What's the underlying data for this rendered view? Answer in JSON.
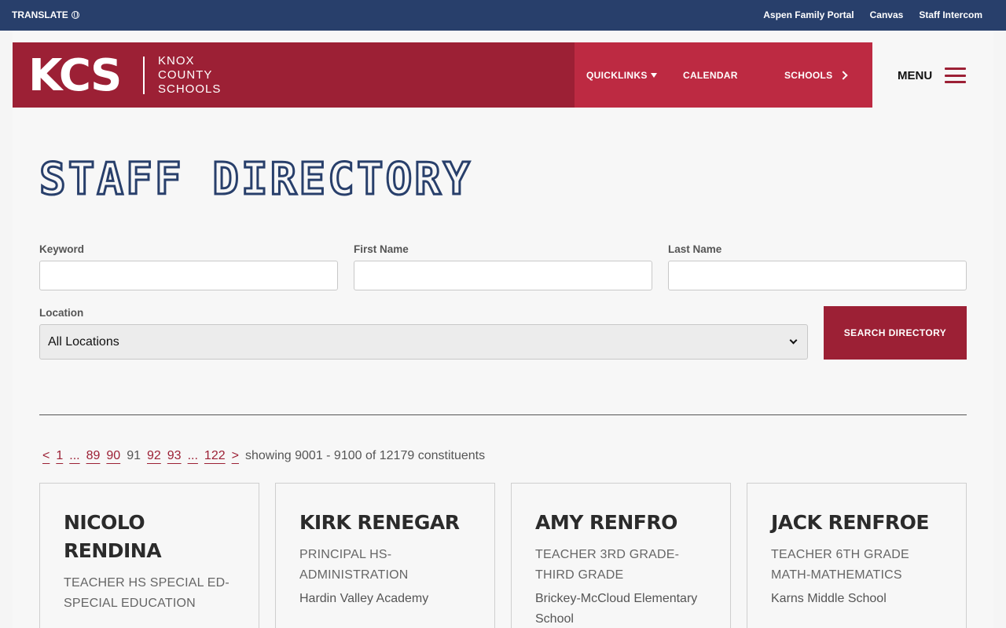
{
  "topbar": {
    "translate": "TRANSLATE",
    "links": [
      "Aspen Family Portal",
      "Canvas",
      "Staff Intercom"
    ]
  },
  "brand": {
    "logo": "KCS",
    "name_lines": [
      "KNOX",
      "COUNTY",
      "SCHOOLS"
    ]
  },
  "nav": {
    "quicklinks": "QUICKLINKS",
    "calendar": "CALENDAR",
    "schools": "SCHOOLS",
    "menu": "MENU"
  },
  "page": {
    "title": "STAFF DIRECTORY"
  },
  "form": {
    "keyword_label": "Keyword",
    "first_name_label": "First Name",
    "last_name_label": "Last Name",
    "location_label": "Location",
    "location_value": "All Locations",
    "search_button": "SEARCH DIRECTORY"
  },
  "pagination": {
    "prev": "<",
    "next": ">",
    "pages": [
      "1",
      "...",
      "89",
      "90",
      "91",
      "92",
      "93",
      "...",
      "122"
    ],
    "current": "91",
    "summary": "showing 9001 - 9100 of 12179 constituents"
  },
  "cards": [
    {
      "name": "NICOLO RENDINA",
      "title": "TEACHER HS SPECIAL ED-SPECIAL EDUCATION",
      "location": ""
    },
    {
      "name": "KIRK RENEGAR",
      "title": "PRINCIPAL HS-ADMINISTRATION",
      "location": "Hardin Valley Academy"
    },
    {
      "name": "AMY RENFRO",
      "title": "TEACHER 3RD GRADE-THIRD GRADE",
      "location": "Brickey-McCloud Elementary School"
    },
    {
      "name": "JACK RENFROE",
      "title": "TEACHER 6TH GRADE MATH-MATHEMATICS",
      "location": "Karns Middle School"
    }
  ],
  "colors": {
    "navy": "#283f6b",
    "brand_red": "#9c2035",
    "nav_red": "#bd2a42"
  }
}
